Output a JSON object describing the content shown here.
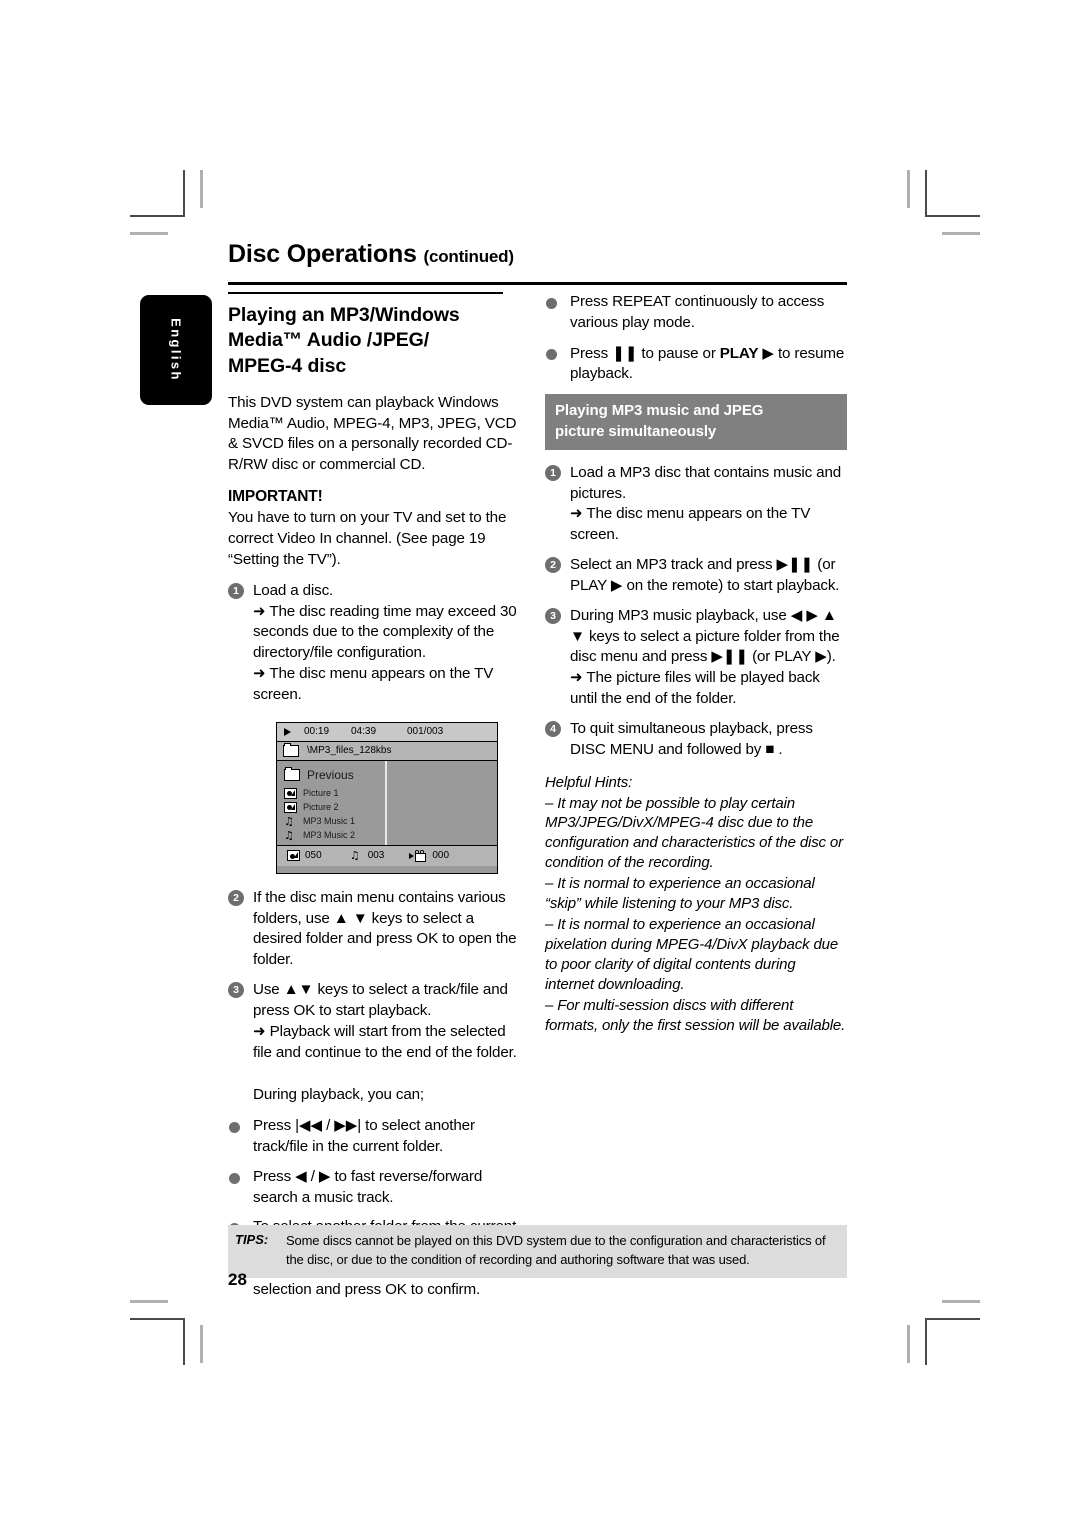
{
  "header": {
    "title": "Disc Operations",
    "continued": "(continued)"
  },
  "language_tab": {
    "label": "English"
  },
  "left_column": {
    "section_heading_line1": "Playing an MP3/Windows",
    "section_heading_line2": "Media™ Audio /JPEG/",
    "section_heading_line3": "MPEG-4 disc",
    "intro": "This DVD system can playback Windows Media™ Audio, MPEG-4, MP3, JPEG, VCD & SVCD files on a personally recorded CD-R/RW disc or commercial CD.",
    "important_label": "IMPORTANT!",
    "important_text": "You have to turn on your TV and set to the correct Video In channel.  (See page 19 “Setting the TV”).",
    "step1_num": "1",
    "step1_text": "Load a disc.",
    "step1_arrow1": "➜ The disc reading time may exceed 30 seconds due to the complexity of the directory/file configuration.",
    "step1_arrow2": "➜ The disc menu appears on the TV screen.",
    "step2_num": "2",
    "step2_text": "If the disc main menu contains various folders, use ▲ ▼ keys to select a desired folder and press OK to open the folder.",
    "step3_num": "3",
    "step3_text": "Use ▲▼ keys to select a track/file and press OK to start playback.",
    "step3_arrow": "➜ Playback will start from the selected file and continue to the end of the folder.",
    "during_playback": "During playback, you can;",
    "bullet1": "Press |◀◀ / ▶▶| to select another track/file in the current folder.",
    "bullet2": "Press ◀ / ▶ to fast reverse/forward search a music track.",
    "bullet3": "To select another folder from the current disc, press ▲ to return to the root menu, then use ▲▼ keys to make your selection and press OK to confirm."
  },
  "tv_screen": {
    "status_play_icon": "play-icon",
    "elapsed_time": "00:19",
    "total_time": "04:39",
    "track_counter": "001/003",
    "folder_path": "\\MP3_files_128kbs",
    "items": [
      {
        "icon": "folder-icon",
        "label": "Previous"
      },
      {
        "icon": "picture-file-icon",
        "label": "Picture 1"
      },
      {
        "icon": "picture-file-icon",
        "label": "Picture 2"
      },
      {
        "icon": "music-note-icon",
        "label": "MP3 Music 1"
      },
      {
        "icon": "music-note-icon",
        "label": "MP3 Music 2"
      }
    ],
    "footer": {
      "picture_icon": "picture-count-icon",
      "picture_count": "050",
      "music_icon": "music-count-icon",
      "music_count": "003",
      "video_icon": "video-count-icon",
      "video_count": "000"
    }
  },
  "right_column": {
    "bullet1": "Press REPEAT continuously to access various play mode.",
    "bullet1_bold": "REPEAT",
    "bullet2_pre": "Press ",
    "bullet2_pause": "❚❚",
    "bullet2_mid": " to pause or ",
    "bullet2_play": "PLAY",
    "bullet2_post": " ▶ to resume playback.",
    "grey_heading_line1": "Playing MP3 music and JPEG",
    "grey_heading_line2": "picture simultaneously",
    "step1_num": "1",
    "step1_text": "Load a MP3 disc that contains music and pictures.",
    "step1_arrow": "➜ The disc menu appears on the TV screen.",
    "step2_num": "2",
    "step2_text": "Select an MP3 track and press ▶❚❚ (or PLAY ▶ on the remote) to start playback.",
    "step3_num": "3",
    "step3_text": "During MP3 music playback, use ◀ ▶ ▲ ▼ keys to select a picture folder from the disc menu and press ▶❚❚ (or PLAY ▶).",
    "step3_arrow": "➜ The picture files will be played back until the end of the folder.",
    "step4_num": "4",
    "step4_text": "To quit simultaneous playback, press DISC MENU and followed by ■ .",
    "hints_title": "Helpful Hints:",
    "hint1": "–  It may not be possible to play certain MP3/JPEG/DivX/MPEG-4 disc due to the configuration and characteristics of the disc or condition of the recording.",
    "hint2": "–  It is normal to experience an occasional “skip” while listening to your MP3 disc.",
    "hint3": "–  It is normal to experience an occasional pixelation during MPEG-4/DivX playback due to poor clarity of digital contents during internet downloading.",
    "hint4": "–  For multi-session discs with different formats, only the first session will be available."
  },
  "tips": {
    "label": "TIPS:",
    "text": "Some discs cannot be played on this DVD system due to the configuration and characteristics of the disc, or due to the condition of recording and authoring software that was used."
  },
  "page_number": "28",
  "colors": {
    "grey_heading_bg": "#808080",
    "tips_bg": "#dcdcdc",
    "bullet_dot": "#6e6e6e",
    "step_circle": "#6e6e6e",
    "tab_bg": "#000000"
  }
}
